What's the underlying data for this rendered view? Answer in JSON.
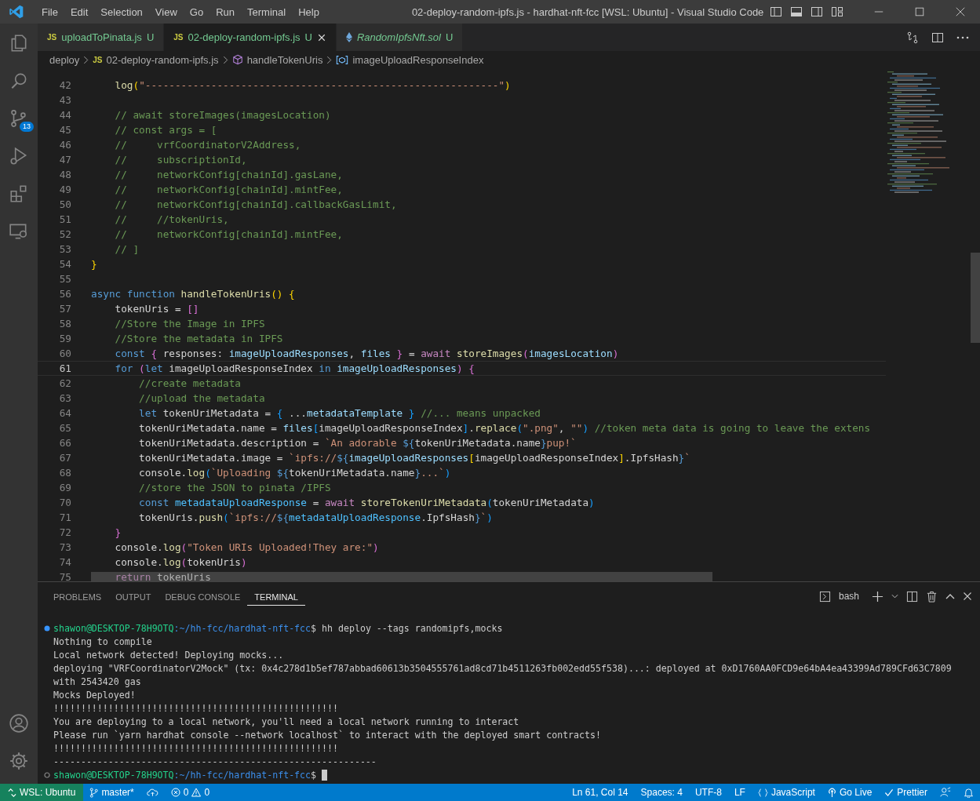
{
  "window": {
    "title": "02-deploy-random-ipfs.js - hardhat-nft-fcc [WSL: Ubuntu] - Visual Studio Code"
  },
  "menu": [
    "File",
    "Edit",
    "Selection",
    "View",
    "Go",
    "Run",
    "Terminal",
    "Help"
  ],
  "activity_bar": {
    "source_control_badge": "13"
  },
  "tabs": [
    {
      "kind": "js",
      "badge": "JS",
      "label": "uploadToPinata.js",
      "status": "U",
      "selected": false,
      "preview": false
    },
    {
      "kind": "js",
      "badge": "JS",
      "label": "02-deploy-random-ipfs.js",
      "status": "U",
      "selected": true,
      "preview": false
    },
    {
      "kind": "sol",
      "label": "RandomIpfsNft.sol",
      "status": "U",
      "selected": false,
      "preview": true
    }
  ],
  "breadcrumbs": [
    {
      "kind": "folder",
      "label": "deploy"
    },
    {
      "kind": "js",
      "badge": "JS",
      "label": "02-deploy-random-ipfs.js"
    },
    {
      "kind": "function",
      "label": "handleTokenUris"
    },
    {
      "kind": "variable",
      "label": "imageUploadResponseIndex"
    }
  ],
  "editor": {
    "lines": [
      {
        "number": "42",
        "current": false,
        "tokens": [
          {
            "text": "    log",
            "kind": "func"
          },
          {
            "text": "(",
            "kind": "brace1"
          },
          {
            "text": "\"-----------------------------------------------------------\"",
            "kind": "string"
          },
          {
            "text": ")",
            "kind": "brace1"
          }
        ]
      },
      {
        "number": "43",
        "current": false
      },
      {
        "number": "44",
        "current": false,
        "tokens": [
          {
            "text": "    // await storeImages(imagesLocation)",
            "kind": "comment"
          }
        ]
      },
      {
        "number": "45",
        "current": false,
        "tokens": [
          {
            "text": "    // const args = [",
            "kind": "comment"
          }
        ]
      },
      {
        "number": "46",
        "current": false,
        "tokens": [
          {
            "text": "    //     vrfCoordinatorV2Address,",
            "kind": "comment"
          }
        ]
      },
      {
        "number": "47",
        "current": false,
        "tokens": [
          {
            "text": "    //     subscriptionId,",
            "kind": "comment"
          }
        ]
      },
      {
        "number": "48",
        "current": false,
        "tokens": [
          {
            "text": "    //     networkConfig[chainId].gasLane,",
            "kind": "comment"
          }
        ]
      },
      {
        "number": "49",
        "current": false,
        "tokens": [
          {
            "text": "    //     networkConfig[chainId].mintFee,",
            "kind": "comment"
          }
        ]
      },
      {
        "number": "50",
        "current": false,
        "tokens": [
          {
            "text": "    //     networkConfig[chainId].callbackGasLimit,",
            "kind": "comment"
          }
        ]
      },
      {
        "number": "51",
        "current": false,
        "tokens": [
          {
            "text": "    //     //tokenUris,",
            "kind": "comment"
          }
        ]
      },
      {
        "number": "52",
        "current": false,
        "tokens": [
          {
            "text": "    //     networkConfig[chainId].mintFee,",
            "kind": "comment"
          }
        ]
      },
      {
        "number": "53",
        "current": false,
        "tokens": [
          {
            "text": "    // ]",
            "kind": "comment"
          }
        ]
      },
      {
        "number": "54",
        "current": false,
        "tokens": [
          {
            "text": "}",
            "kind": "brace1"
          }
        ]
      },
      {
        "number": "55",
        "current": false
      },
      {
        "number": "56",
        "current": false,
        "tokens": [
          {
            "text": "async function ",
            "kind": "keyword"
          },
          {
            "text": "handleTokenUris",
            "kind": "func"
          },
          {
            "text": "() {",
            "kind": "brace1"
          }
        ]
      },
      {
        "number": "57",
        "current": false,
        "tokens": [
          {
            "text": "    tokenUris ",
            "kind": "plain"
          },
          {
            "text": "= ",
            "kind": "plain"
          },
          {
            "text": "[]",
            "kind": "brace2"
          }
        ]
      },
      {
        "number": "58",
        "current": false,
        "tokens": [
          {
            "text": "    //Store the Image in IPFS",
            "kind": "comment"
          }
        ]
      },
      {
        "number": "59",
        "current": false,
        "tokens": [
          {
            "text": "    //Store the metadata in IPFS",
            "kind": "comment"
          }
        ]
      },
      {
        "number": "60",
        "current": false,
        "tokens": [
          {
            "text": "    const ",
            "kind": "keyword"
          },
          {
            "text": "{ ",
            "kind": "brace2"
          },
          {
            "text": "responses",
            "kind": "plain"
          },
          {
            "text": ": ",
            "kind": "plain"
          },
          {
            "text": "imageUploadResponses",
            "kind": "var"
          },
          {
            "text": ", ",
            "kind": "plain"
          },
          {
            "text": "files",
            "kind": "var"
          },
          {
            "text": " }",
            "kind": "brace2"
          },
          {
            "text": " = ",
            "kind": "plain"
          },
          {
            "text": "await ",
            "kind": "control"
          },
          {
            "text": "storeImages",
            "kind": "func"
          },
          {
            "text": "(",
            "kind": "brace2"
          },
          {
            "text": "imagesLocation",
            "kind": "var"
          },
          {
            "text": ")",
            "kind": "brace2"
          }
        ]
      },
      {
        "number": "61",
        "current": true,
        "tokens": [
          {
            "text": "    for ",
            "kind": "keyword"
          },
          {
            "text": "(",
            "kind": "brace2"
          },
          {
            "text": "let ",
            "kind": "keyword"
          },
          {
            "text": "imageUploadResponseIndex ",
            "kind": "plain"
          },
          {
            "text": "in ",
            "kind": "keyword"
          },
          {
            "text": "imageUploadResponses",
            "kind": "var"
          },
          {
            "text": ") {",
            "kind": "brace2"
          }
        ]
      },
      {
        "number": "62",
        "current": false,
        "tokens": [
          {
            "text": "        //create metadata",
            "kind": "comment"
          }
        ]
      },
      {
        "number": "63",
        "current": false,
        "tokens": [
          {
            "text": "        //upload the metadata",
            "kind": "comment"
          }
        ]
      },
      {
        "number": "64",
        "current": false,
        "tokens": [
          {
            "text": "        let ",
            "kind": "keyword"
          },
          {
            "text": "tokenUriMetadata ",
            "kind": "plain"
          },
          {
            "text": "= ",
            "kind": "plain"
          },
          {
            "text": "{ ",
            "kind": "brace3"
          },
          {
            "text": "...",
            "kind": "plain"
          },
          {
            "text": "metadataTemplate",
            "kind": "var"
          },
          {
            "text": " }",
            "kind": "brace3"
          },
          {
            "text": " //... means unpacked",
            "kind": "comment"
          }
        ]
      },
      {
        "number": "65",
        "current": false,
        "tokens": [
          {
            "text": "        tokenUriMetadata.name = ",
            "kind": "plain"
          },
          {
            "text": "files",
            "kind": "var"
          },
          {
            "text": "[",
            "kind": "brace3"
          },
          {
            "text": "imageUploadResponseIndex",
            "kind": "plain"
          },
          {
            "text": "]",
            "kind": "brace3"
          },
          {
            "text": ".",
            "kind": "plain"
          },
          {
            "text": "replace",
            "kind": "func"
          },
          {
            "text": "(",
            "kind": "brace3"
          },
          {
            "text": "\".png\"",
            "kind": "string"
          },
          {
            "text": ", ",
            "kind": "plain"
          },
          {
            "text": "\"\"",
            "kind": "string"
          },
          {
            "text": ")",
            "kind": "brace3"
          },
          {
            "text": " //token meta data is going to leave the extens",
            "kind": "comment"
          }
        ]
      },
      {
        "number": "66",
        "current": false,
        "tokens": [
          {
            "text": "        tokenUriMetadata.description = ",
            "kind": "plain"
          },
          {
            "text": "`An adorable ",
            "kind": "string"
          },
          {
            "text": "${",
            "kind": "keyword"
          },
          {
            "text": "tokenUriMetadata.name",
            "kind": "plain"
          },
          {
            "text": "}",
            "kind": "keyword"
          },
          {
            "text": "pup!`",
            "kind": "string"
          }
        ]
      },
      {
        "number": "67",
        "current": false,
        "tokens": [
          {
            "text": "        tokenUriMetadata.image = ",
            "kind": "plain"
          },
          {
            "text": "`ipfs://",
            "kind": "string"
          },
          {
            "text": "${",
            "kind": "keyword"
          },
          {
            "text": "imageUploadResponses",
            "kind": "var"
          },
          {
            "text": "[",
            "kind": "brace1"
          },
          {
            "text": "imageUploadResponseIndex",
            "kind": "plain"
          },
          {
            "text": "]",
            "kind": "brace1"
          },
          {
            "text": ".IpfsHash",
            "kind": "plain"
          },
          {
            "text": "}",
            "kind": "keyword"
          },
          {
            "text": "`",
            "kind": "string"
          }
        ]
      },
      {
        "number": "68",
        "current": false,
        "tokens": [
          {
            "text": "        console.",
            "kind": "plain"
          },
          {
            "text": "log",
            "kind": "func"
          },
          {
            "text": "(",
            "kind": "brace3"
          },
          {
            "text": "`Uploading ",
            "kind": "string"
          },
          {
            "text": "${",
            "kind": "keyword"
          },
          {
            "text": "tokenUriMetadata.name",
            "kind": "plain"
          },
          {
            "text": "}",
            "kind": "keyword"
          },
          {
            "text": "...`",
            "kind": "string"
          },
          {
            "text": ")",
            "kind": "brace3"
          }
        ]
      },
      {
        "number": "69",
        "current": false,
        "tokens": [
          {
            "text": "        //store the JSON to pinata /IPFS",
            "kind": "comment"
          }
        ]
      },
      {
        "number": "70",
        "current": false,
        "tokens": [
          {
            "text": "        const ",
            "kind": "keyword"
          },
          {
            "text": "metadataUploadResponse",
            "kind": "const"
          },
          {
            "text": " = ",
            "kind": "plain"
          },
          {
            "text": "await ",
            "kind": "control"
          },
          {
            "text": "storeTokenUriMetadata",
            "kind": "func"
          },
          {
            "text": "(",
            "kind": "brace3"
          },
          {
            "text": "tokenUriMetadata",
            "kind": "plain"
          },
          {
            "text": ")",
            "kind": "brace3"
          }
        ]
      },
      {
        "number": "71",
        "current": false,
        "tokens": [
          {
            "text": "        tokenUris.",
            "kind": "plain"
          },
          {
            "text": "push",
            "kind": "func"
          },
          {
            "text": "(",
            "kind": "brace3"
          },
          {
            "text": "`ipfs://",
            "kind": "string"
          },
          {
            "text": "${",
            "kind": "keyword"
          },
          {
            "text": "metadataUploadResponse",
            "kind": "const"
          },
          {
            "text": ".IpfsHash",
            "kind": "plain"
          },
          {
            "text": "}",
            "kind": "keyword"
          },
          {
            "text": "`",
            "kind": "string"
          },
          {
            "text": ")",
            "kind": "brace3"
          }
        ]
      },
      {
        "number": "72",
        "current": false,
        "tokens": [
          {
            "text": "    }",
            "kind": "brace2"
          }
        ]
      },
      {
        "number": "73",
        "current": false,
        "tokens": [
          {
            "text": "    console.",
            "kind": "plain"
          },
          {
            "text": "log",
            "kind": "func"
          },
          {
            "text": "(",
            "kind": "brace2"
          },
          {
            "text": "\"Token URIs Uploaded!They are:\"",
            "kind": "string"
          },
          {
            "text": ")",
            "kind": "brace2"
          }
        ]
      },
      {
        "number": "74",
        "current": false,
        "tokens": [
          {
            "text": "    console.",
            "kind": "plain"
          },
          {
            "text": "log",
            "kind": "func"
          },
          {
            "text": "(",
            "kind": "brace2"
          },
          {
            "text": "tokenUris",
            "kind": "plain"
          },
          {
            "text": ")",
            "kind": "brace2"
          }
        ]
      },
      {
        "number": "75",
        "current": false,
        "tokens": [
          {
            "text": "    return ",
            "kind": "control"
          },
          {
            "text": "tokenUris",
            "kind": "plain"
          }
        ]
      }
    ]
  },
  "panel": {
    "tabs": [
      {
        "label": "PROBLEMS",
        "selected": false
      },
      {
        "label": "OUTPUT",
        "selected": false
      },
      {
        "label": "DEBUG CONSOLE",
        "selected": false
      },
      {
        "label": "TERMINAL",
        "selected": true
      }
    ],
    "shell": "bash"
  },
  "terminal": [
    {
      "kind": "prompt",
      "finished": true,
      "user": "shawon@DESKTOP-78H9OTQ",
      "path": ":~/hh-fcc/hardhat-nft-fcc",
      "command": "$ hh deploy --tags randomipfs,mocks"
    },
    {
      "kind": "output",
      "text": "Nothing to compile"
    },
    {
      "kind": "output",
      "text": "Local network detected! Deploying mocks..."
    },
    {
      "kind": "output",
      "text": "deploying \"VRFCoordinatorV2Mock\" (tx: 0x4c278d1b5ef787abbad60613b3504555761ad8cd71b4511263fb002edd55f538)...: deployed at 0xD1760AA0FCD9e64bA4ea43399Ad789CFd63C7809"
    },
    {
      "kind": "output",
      "text": "with 2543420 gas"
    },
    {
      "kind": "output",
      "text": "Mocks Deployed!"
    },
    {
      "kind": "output",
      "text": "!!!!!!!!!!!!!!!!!!!!!!!!!!!!!!!!!!!!!!!!!!!!!!!!!!!!"
    },
    {
      "kind": "output",
      "text": "You are deploying to a local network, you'll need a local network running to interact"
    },
    {
      "kind": "output",
      "text": "Please run `yarn hardhat console --network localhost` to interact with the deployed smart contracts!"
    },
    {
      "kind": "output",
      "text": "!!!!!!!!!!!!!!!!!!!!!!!!!!!!!!!!!!!!!!!!!!!!!!!!!!!!"
    },
    {
      "kind": "output",
      "text": "-----------------------------------------------------------"
    },
    {
      "kind": "prompt",
      "finished": false,
      "user": "shawon@DESKTOP-78H9OTQ",
      "path": ":~/hh-fcc/hardhat-nft-fcc",
      "command": "$ ",
      "cursor": true
    }
  ],
  "status_bar": {
    "left": [
      {
        "kind": "remote",
        "label": "WSL: Ubuntu"
      },
      {
        "kind": "branch",
        "label": "master*"
      },
      {
        "kind": "sync"
      },
      {
        "kind": "problems",
        "errors": "0",
        "warnings": "0"
      }
    ],
    "right": [
      {
        "kind": "text",
        "label": "Ln 61, Col 14"
      },
      {
        "kind": "text",
        "label": "Spaces: 4"
      },
      {
        "kind": "text",
        "label": "UTF-8"
      },
      {
        "kind": "text",
        "label": "LF"
      },
      {
        "kind": "language",
        "label": "JavaScript"
      },
      {
        "kind": "golive",
        "label": "Go Live"
      },
      {
        "kind": "prettier",
        "label": "Prettier"
      },
      {
        "kind": "feedback"
      },
      {
        "kind": "bell"
      }
    ]
  }
}
